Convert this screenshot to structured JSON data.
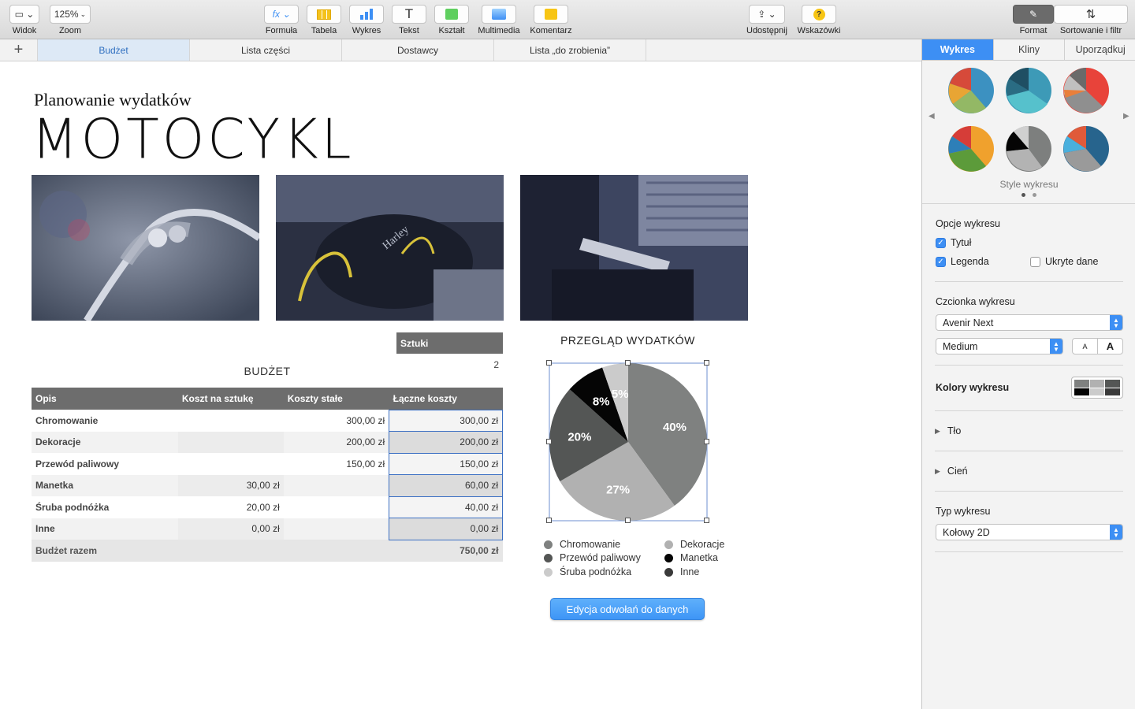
{
  "toolbar": {
    "view_label": "Widok",
    "zoom_value": "125%",
    "zoom_label": "Zoom",
    "formula_label": "Formuła",
    "table_label": "Tabela",
    "chart_label": "Wykres",
    "text_label": "Tekst",
    "shape_label": "Kształt",
    "media_label": "Multimedia",
    "comment_label": "Komentarz",
    "share_label": "Udostępnij",
    "tips_label": "Wskazówki",
    "format_label": "Format",
    "sort_label": "Sortowanie i filtr"
  },
  "sheets": {
    "tabs": [
      "Budżet",
      "Lista części",
      "Dostawcy",
      "Lista „do zrobienia”"
    ]
  },
  "page": {
    "subtitle": "Planowanie wydatków",
    "title": "MOTOCYKL"
  },
  "budget": {
    "title": "BUDŻET",
    "sztuki_header": "Sztuki",
    "sztuki_value": "2",
    "headers": [
      "Opis",
      "Koszt na sztukę",
      "Koszty stałe",
      "Łączne koszty"
    ],
    "rows": [
      [
        "Chromowanie",
        "",
        "300,00 zł",
        "300,00 zł"
      ],
      [
        "Dekoracje",
        "",
        "200,00 zł",
        "200,00 zł"
      ],
      [
        "Przewód paliwowy",
        "",
        "150,00 zł",
        "150,00 zł"
      ],
      [
        "Manetka",
        "30,00 zł",
        "",
        "60,00 zł"
      ],
      [
        "Śruba podnóżka",
        "20,00 zł",
        "",
        "40,00 zł"
      ],
      [
        "Inne",
        "0,00 zł",
        "",
        "0,00 zł"
      ]
    ],
    "total_label": "Budżet razem",
    "total_value": "750,00 zł"
  },
  "chart_data": {
    "type": "pie",
    "title": "PRZEGLĄD WYDATKÓW",
    "categories": [
      "Chromowanie",
      "Dekoracje",
      "Przewód paliwowy",
      "Manetka",
      "Śruba podnóżka",
      "Inne"
    ],
    "values": [
      300,
      200,
      150,
      60,
      40,
      0
    ],
    "labels": [
      "40%",
      "27%",
      "20%",
      "8%",
      "5%",
      ""
    ],
    "colors": [
      "#7f8180",
      "#b1b1b1",
      "#545655",
      "#050505",
      "#cbcbcb",
      "#3a3a3a"
    ],
    "legend": "bottom"
  },
  "edit_button": "Edycja odwołań do danych",
  "panel": {
    "tabs": [
      "Wykres",
      "Kliny",
      "Uporządkuj"
    ],
    "styles_label": "Style wykresu",
    "options_header": "Opcje wykresu",
    "title_option": "Tytuł",
    "legend_option": "Legenda",
    "hidden_option": "Ukryte dane",
    "font_header": "Czcionka wykresu",
    "font_value": "Avenir Next",
    "weight_value": "Medium",
    "small_a": "A",
    "big_a": "A",
    "colors_header": "Kolory wykresu",
    "background_label": "Tło",
    "shadow_label": "Cień",
    "type_header": "Typ wykresu",
    "type_value": "Kołowy 2D"
  }
}
